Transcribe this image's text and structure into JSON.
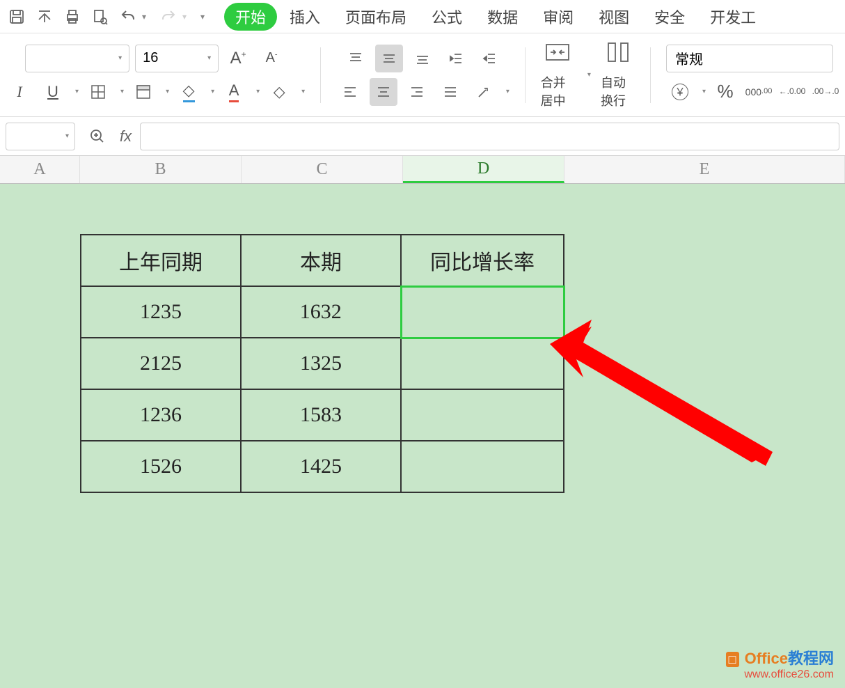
{
  "quick": {
    "save": "💾",
    "print": "🖨",
    "preview": "🔍",
    "undo": "↶",
    "redo": "↷"
  },
  "tabs": {
    "start": "开始",
    "insert": "插入",
    "layout": "页面布局",
    "formula": "公式",
    "data": "数据",
    "review": "审阅",
    "view": "视图",
    "security": "安全",
    "dev": "开发工"
  },
  "ribbon": {
    "font_size": "16",
    "merge": "合并居中",
    "wrap": "自动换行",
    "num_format": "常规",
    "currency": "￥",
    "percent": "%",
    "comma": "000",
    "inc_dec": "←.0",
    "dec_inc": ".00→",
    "A_plus": "A",
    "A_minus": "A",
    "I": "I",
    "U": "U"
  },
  "formula_bar": {
    "fx": "fx",
    "value": ""
  },
  "cols": {
    "A": "A",
    "B": "B",
    "C": "C",
    "D": "D",
    "E": "E"
  },
  "table": {
    "h1": "上年同期",
    "h2": "本期",
    "h3": "同比增长率",
    "rows": [
      {
        "a": "1235",
        "b": "1632",
        "c": ""
      },
      {
        "a": "2125",
        "b": "1325",
        "c": ""
      },
      {
        "a": "1236",
        "b": "1583",
        "c": ""
      },
      {
        "a": "1526",
        "b": "1425",
        "c": ""
      }
    ]
  },
  "watermark": {
    "line1a": "Office",
    "line1b": "教程网",
    "line2": "www.office26.com"
  }
}
